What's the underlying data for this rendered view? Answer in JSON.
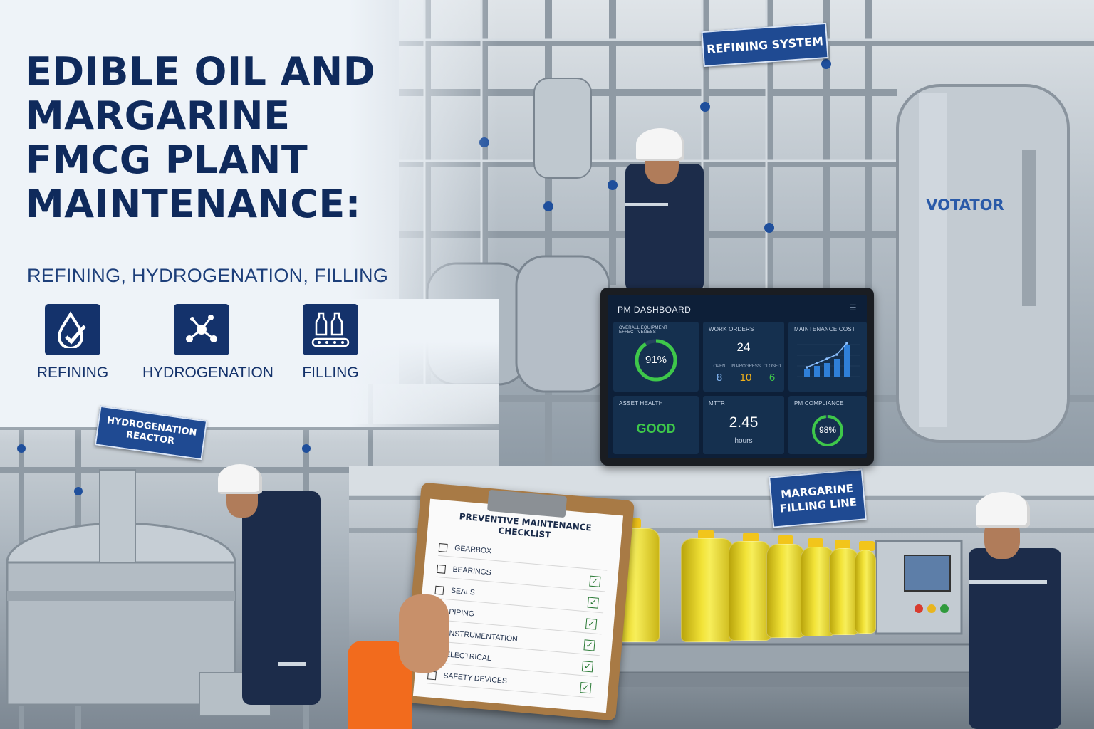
{
  "title": "EDIBLE OIL AND MARGARINE FMCG PLANT MAINTENANCE:",
  "subtitle": "REFINING, HYDROGENATION, FILLING",
  "categories": [
    {
      "label": "REFINING",
      "icon": "oil-drop-check-icon"
    },
    {
      "label": "HYDROGENATION",
      "icon": "molecule-icon"
    },
    {
      "label": "FILLING",
      "icon": "bottles-conveyor-icon"
    }
  ],
  "signs": {
    "refining_system": "REFINING SYSTEM",
    "hydrogenation_reactor": "HYDROGENATION REACTOR",
    "margarine_filling_line": "MARGARINE FILLING LINE",
    "votator": "VOTATOR"
  },
  "dashboard": {
    "title": "PM DASHBOARD",
    "menu_icon": "menu-icon",
    "oee": {
      "label": "OVERALL EQUIPMENT EFFECTIVENESS",
      "value": "91%",
      "fraction": 0.91
    },
    "work_orders": {
      "label": "WORK ORDERS",
      "total": "24",
      "open": {
        "label": "OPEN",
        "value": "8"
      },
      "in_progress": {
        "label": "IN PROGRESS",
        "value": "10"
      },
      "closed": {
        "label": "CLOSED",
        "value": "6"
      }
    },
    "maintenance_cost": {
      "label": "MAINTENANCE COST"
    },
    "asset_health": {
      "label": "ASSET HEALTH",
      "value": "GOOD"
    },
    "mttr": {
      "label": "MTTR",
      "value": "2.45",
      "unit": "hours"
    },
    "pm_compliance": {
      "label": "PM COMPLIANCE",
      "value": "98%",
      "fraction": 0.98
    },
    "colors": {
      "good": "#3ec74a",
      "accent": "#2f7fd8",
      "in_progress": "#f2b21a",
      "open": "#7fb2ee"
    }
  },
  "checklist": {
    "title": "PREVENTIVE MAINTENANCE CHECKLIST",
    "items": [
      {
        "label": "GEARBOX",
        "checked": false
      },
      {
        "label": "BEARINGS",
        "checked": true
      },
      {
        "label": "SEALS",
        "checked": true
      },
      {
        "label": "PIPING",
        "checked": true
      },
      {
        "label": "INSTRUMENTATION",
        "checked": true
      },
      {
        "label": "ELECTRICAL",
        "checked": true
      },
      {
        "label": "SAFETY DEVICES",
        "checked": true
      }
    ]
  },
  "colors": {
    "navy": "#0f2a5c",
    "sign_blue": "#1f4a92",
    "steel": "#b8c1c9"
  }
}
